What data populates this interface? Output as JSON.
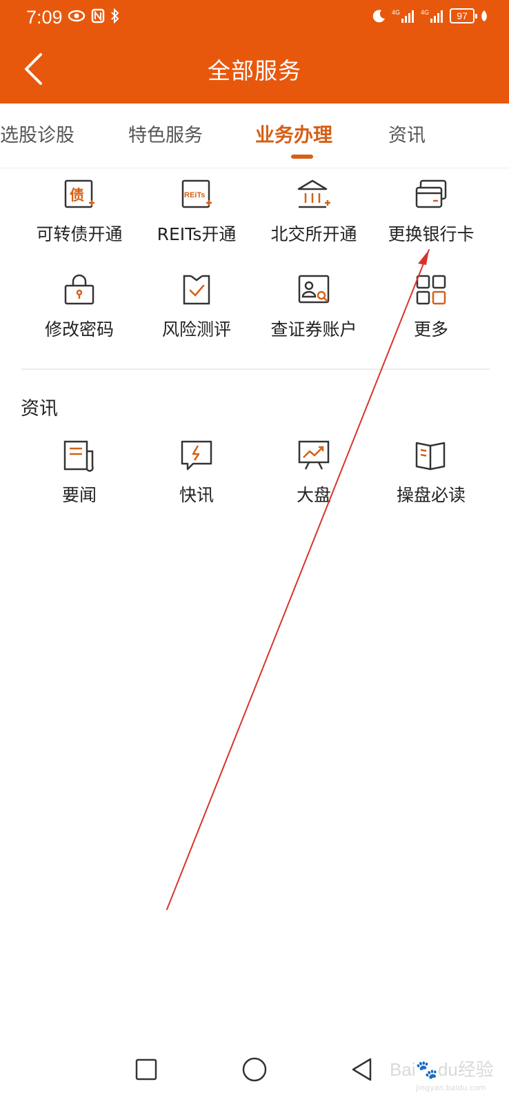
{
  "status_bar": {
    "time": "7:09",
    "battery": "97",
    "network_labels": [
      "4G",
      "4G"
    ]
  },
  "header": {
    "title": "全部服务",
    "background_color": "#e8580c"
  },
  "tabs": [
    {
      "label": "选股诊股",
      "active": false
    },
    {
      "label": "特色服务",
      "active": false
    },
    {
      "label": "业务办理",
      "active": true
    },
    {
      "label": "资讯",
      "active": false
    }
  ],
  "accent_color": "#d65f15",
  "business": {
    "items": [
      {
        "label": "可转债开通",
        "icon": "bond-icon",
        "icon_text": "债"
      },
      {
        "label": "REITs开通",
        "icon": "reits-icon",
        "icon_text": "REiTs"
      },
      {
        "label": "北交所开通",
        "icon": "exchange-building-icon"
      },
      {
        "label": "更换银行卡",
        "icon": "bank-card-icon"
      },
      {
        "label": "修改密码",
        "icon": "lock-icon"
      },
      {
        "label": "风险测评",
        "icon": "checklist-icon"
      },
      {
        "label": "查证券账户",
        "icon": "account-search-icon"
      },
      {
        "label": "更多",
        "icon": "grid-more-icon"
      }
    ]
  },
  "news": {
    "title": "资讯",
    "items": [
      {
        "label": "要闻",
        "icon": "newspaper-icon"
      },
      {
        "label": "快讯",
        "icon": "flash-news-icon"
      },
      {
        "label": "大盘",
        "icon": "market-chart-icon"
      },
      {
        "label": "操盘必读",
        "icon": "book-icon"
      }
    ]
  },
  "nav_bar": {
    "buttons": [
      "recent-apps",
      "home",
      "back"
    ]
  },
  "watermark": {
    "brand": "Bai",
    "brand_suffix": "du",
    "chinese": "经验",
    "domain": "jingyan.baidu.com"
  }
}
